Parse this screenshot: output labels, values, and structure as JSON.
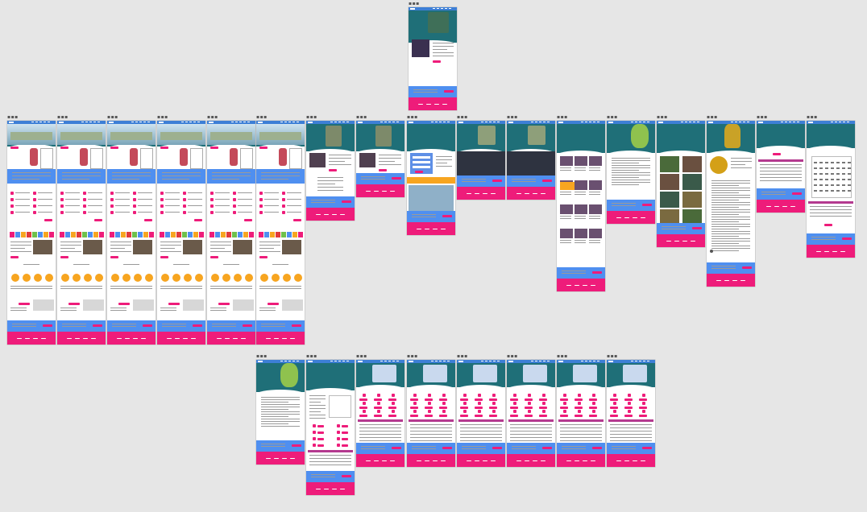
{
  "canvas": {
    "background": "#e6e6e6",
    "frame_label": "▪▪▪"
  },
  "colors": {
    "nav_blue": "#3d7fd6",
    "hero_teal": "#1f6f78",
    "band_blue": "#4f8ff0",
    "accent_pink": "#ee1c7a",
    "table_purple": "#b43a8f",
    "orange": "#f7a520",
    "red": "#e23a3a",
    "green": "#6ec04b"
  },
  "frames": {
    "row1": [
      {
        "name": "frame-top",
        "kind": "profile"
      }
    ],
    "row2": [
      {
        "name": "frame-home-1",
        "kind": "home"
      },
      {
        "name": "frame-home-2",
        "kind": "home"
      },
      {
        "name": "frame-home-3",
        "kind": "home"
      },
      {
        "name": "frame-home-4",
        "kind": "home"
      },
      {
        "name": "frame-home-5",
        "kind": "home"
      },
      {
        "name": "frame-home-6",
        "kind": "home"
      },
      {
        "name": "frame-news-a",
        "kind": "news"
      },
      {
        "name": "frame-news-b",
        "kind": "news"
      },
      {
        "name": "frame-contact",
        "kind": "contact"
      },
      {
        "name": "frame-gallery-a",
        "kind": "gallery"
      },
      {
        "name": "frame-gallery-b",
        "kind": "gallery"
      },
      {
        "name": "frame-staff",
        "kind": "staff"
      },
      {
        "name": "frame-article",
        "kind": "article"
      },
      {
        "name": "frame-photos",
        "kind": "photos"
      },
      {
        "name": "frame-award",
        "kind": "award"
      },
      {
        "name": "frame-download",
        "kind": "table"
      },
      {
        "name": "frame-calendar",
        "kind": "calendar"
      }
    ],
    "row3": [
      {
        "name": "frame-article-2",
        "kind": "article"
      },
      {
        "name": "frame-event-list",
        "kind": "event"
      },
      {
        "name": "frame-agenda-1",
        "kind": "agenda"
      },
      {
        "name": "frame-agenda-2",
        "kind": "agenda"
      },
      {
        "name": "frame-agenda-3",
        "kind": "agenda"
      },
      {
        "name": "frame-agenda-4",
        "kind": "agenda"
      },
      {
        "name": "frame-agenda-5",
        "kind": "agenda"
      },
      {
        "name": "frame-agenda-6",
        "kind": "agenda"
      }
    ]
  }
}
